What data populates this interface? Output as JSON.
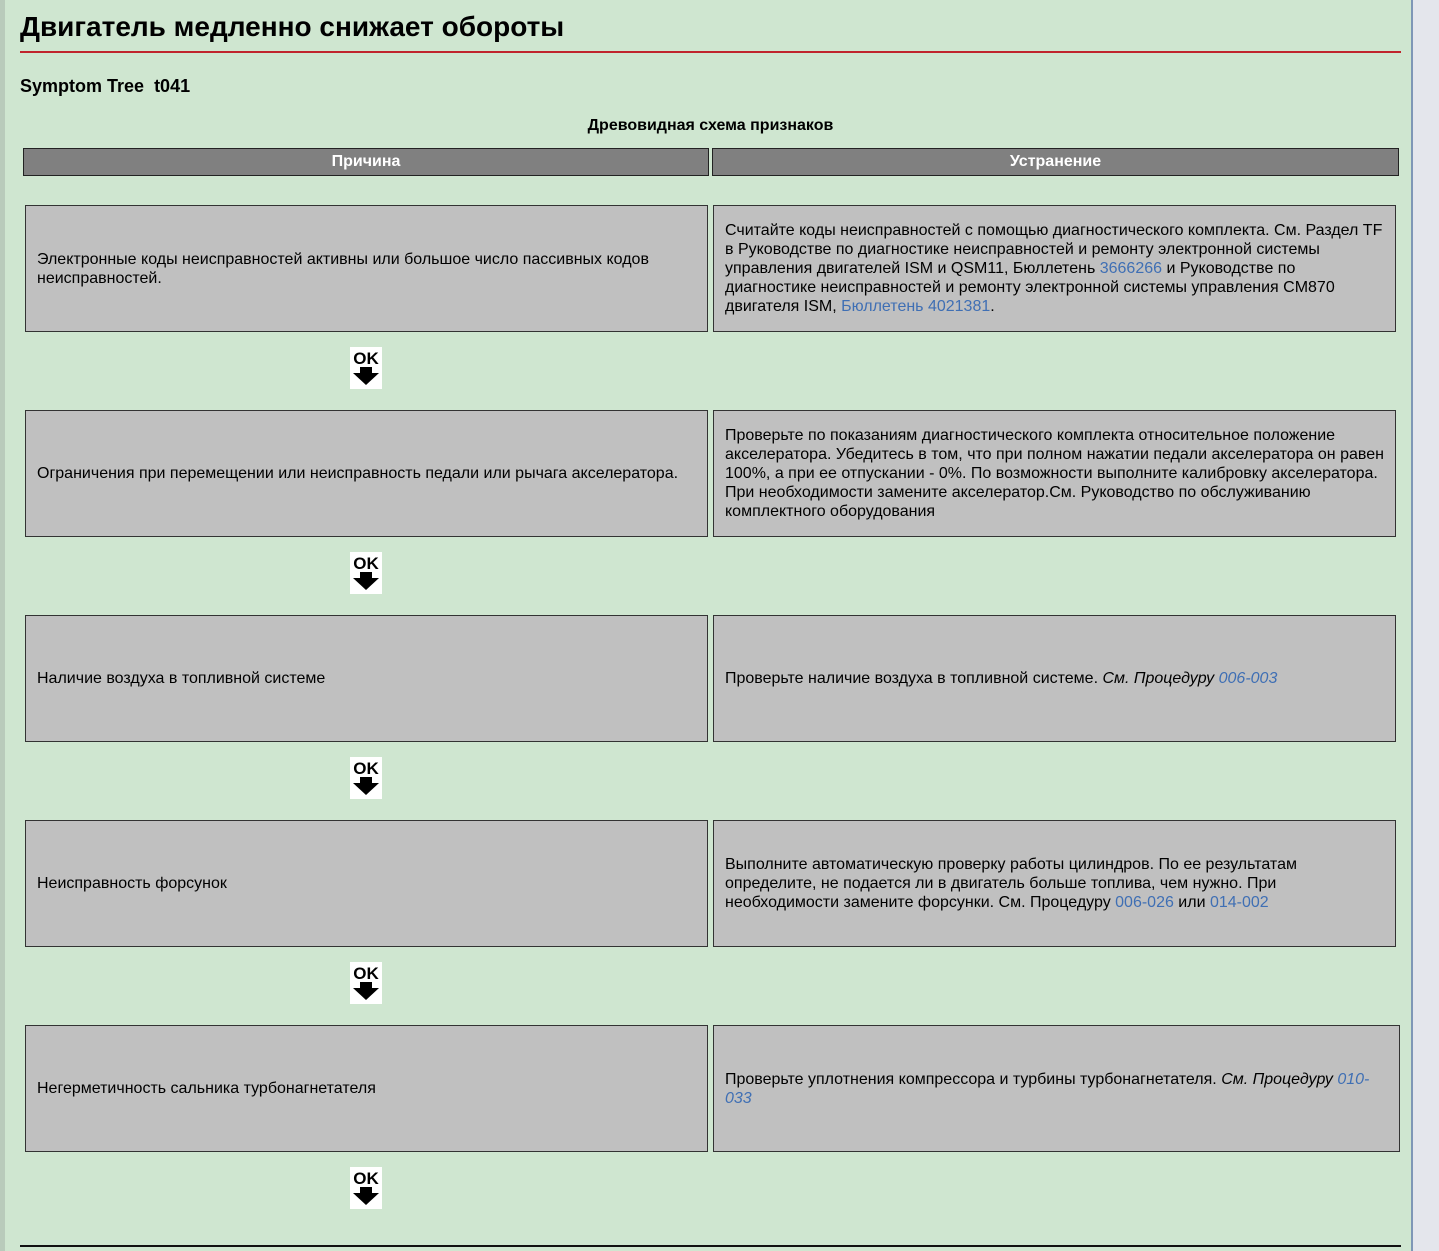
{
  "page": {
    "title": "Двигатель медленно снижает обороты",
    "symptom_label": "Symptom Tree",
    "symptom_code": "t041",
    "tree_title": "Древовидная схема признаков"
  },
  "table": {
    "header_cause": "Причина",
    "header_fix": "Устранение",
    "ok_label": "OK"
  },
  "steps": [
    {
      "cause": "Электронные коды неисправностей активны или большое число пассивных кодов неисправностей.",
      "fix_1": "Считайте коды неисправностей с помощью диагностического комплекта. См. Раздел TF в Руководстве по диагностике неисправностей и ремонту электронной системы управления двигателей ISM и QSM11, Бюллетень ",
      "link_1": "3666266",
      "fix_2": " и Руководстве по диагностике неисправностей и ремонту электронной системы управления CM870 двигателя ISM, ",
      "link_2": "Бюллетень 4021381",
      "fix_3": "."
    },
    {
      "cause": "Ограничения при перемещении или неисправность педали или рычага акселератора.",
      "fix_1": "Проверьте по показаниям диагностического комплекта относительное положение акселератора. Убедитесь в том, что при полном нажатии педали акселератора он равен 100%, а при ее отпускании - 0%. По возможности выполните калибровку акселератора. При необходимости замените акселератор.См. Руководство по обслуживанию комплектного оборудования"
    },
    {
      "cause": "Наличие воздуха в топливной системе",
      "fix_1": "Проверьте наличие воздуха в топливной системе. ",
      "ref_label": "См. Процедуру",
      "link_1": "006-003"
    },
    {
      "cause": "Неисправность форсунок",
      "fix_1": "Выполните автоматическую проверку работы цилиндров. По ее результатам определите, не подается ли в двигатель больше топлива, чем нужно. При необходимости замените форсунки. См. Процедуру ",
      "link_1": "006-026",
      "fix_2": " или ",
      "link_2": "014-002"
    },
    {
      "cause": "Негерметичность сальника турбонагнетателя",
      "fix_1": "Проверьте уплотнения компрессора и турбины турбонагнетателя. ",
      "ref_label": "См. Процедуру",
      "link_1": "010-033"
    }
  ]
}
